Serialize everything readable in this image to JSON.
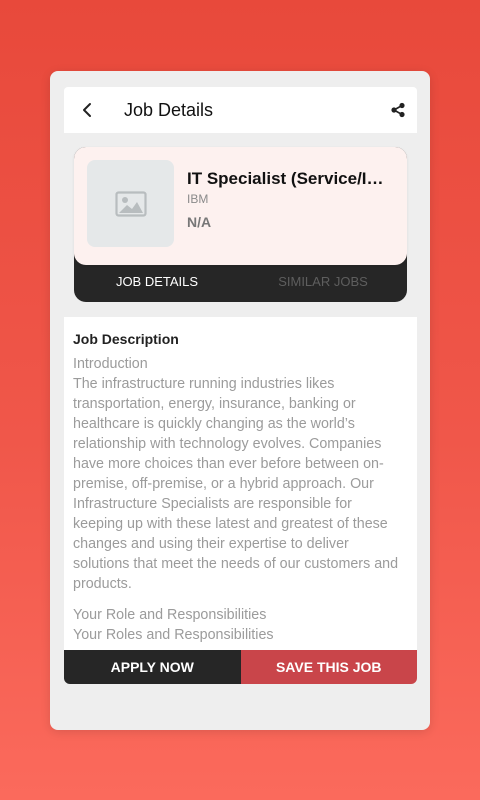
{
  "header": {
    "title": "Job Details",
    "back_icon": "chevron-left-icon",
    "share_icon": "share-icon"
  },
  "job": {
    "title": "IT Specialist (Service/Infrastructure)",
    "company": "IBM",
    "location": "N/A",
    "logo_icon": "image-placeholder-icon"
  },
  "tabs": [
    {
      "label": "JOB DETAILS",
      "active": true
    },
    {
      "label": "SIMILAR JOBS",
      "active": false
    }
  ],
  "description": {
    "heading": "Job Description",
    "intro_label": "Introduction",
    "intro_text": "The infrastructure running industries likes transportation, energy, insurance, banking or healthcare is quickly changing as the world’s relationship with technology evolves. Companies have more choices than ever before between on-premise, off-premise, or a hybrid approach. Our Infrastructure Specialists are responsible for keeping up with these latest and greatest of these changes and using their expertise to deliver solutions that meet the needs of our customers and products.",
    "role_label": "Your Role and Responsibilities",
    "roles_label": "Your Roles and Responsibilities"
  },
  "actions": {
    "apply_label": "APPLY NOW",
    "save_label": "SAVE THIS JOB"
  },
  "colors": {
    "background": "#f0574a",
    "dark": "#262626",
    "accent": "#c9454a",
    "card": "#fdf1ef"
  }
}
